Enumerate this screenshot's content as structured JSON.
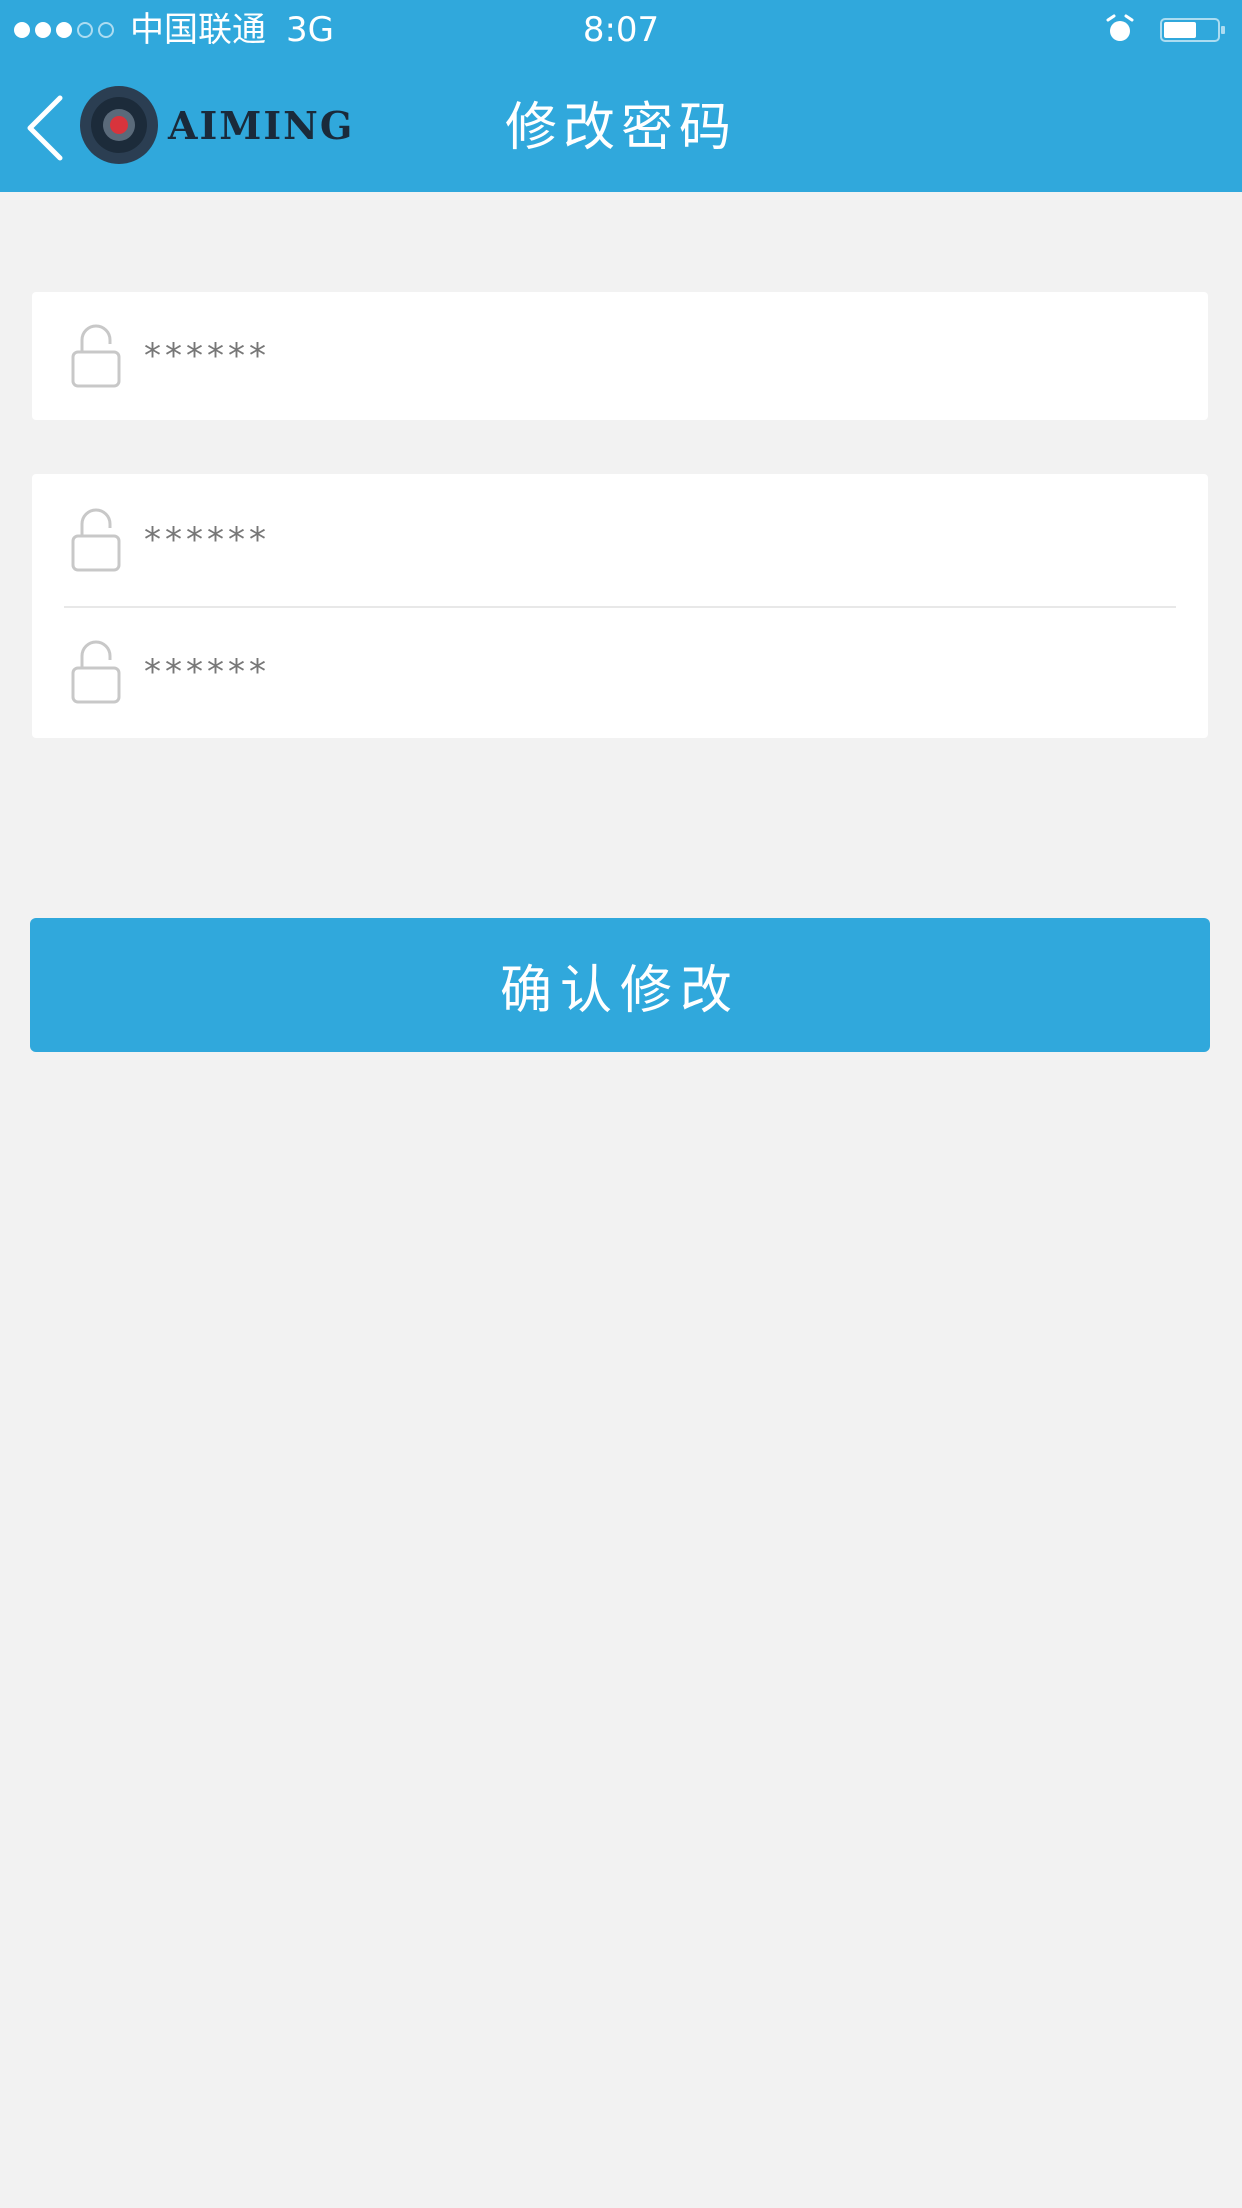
{
  "status_bar": {
    "carrier": "中国联通",
    "network": "3G",
    "time": "8:07",
    "signal_bars_filled": 3,
    "signal_bars_total": 5
  },
  "nav": {
    "title": "修改密码",
    "logo_text": "AIMING",
    "back_icon": "chevron-left-icon"
  },
  "form": {
    "old_password": {
      "placeholder": "******",
      "icon": "lock-icon"
    },
    "new_password": {
      "placeholder": "******",
      "icon": "lock-icon"
    },
    "confirm_password": {
      "placeholder": "******",
      "icon": "lock-icon"
    }
  },
  "actions": {
    "confirm_label": "确认修改"
  },
  "colors": {
    "primary": "#30a8dc",
    "background": "#f2f2f2"
  }
}
